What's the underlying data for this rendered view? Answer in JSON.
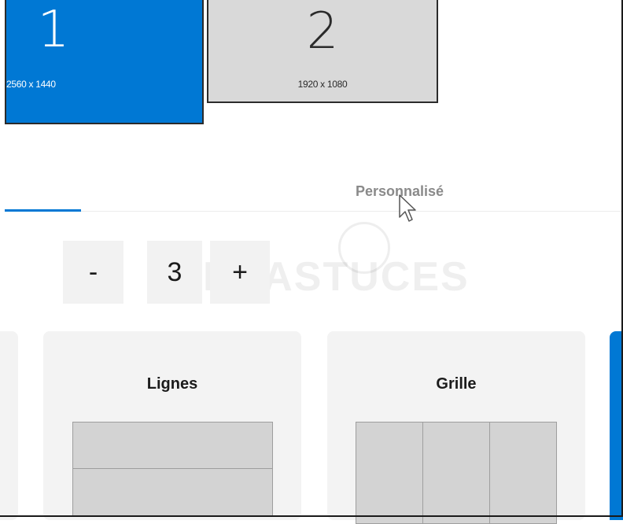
{
  "monitors": [
    {
      "number": "1",
      "resolution": "2560 x 1440",
      "selected": true
    },
    {
      "number": "2",
      "resolution": "1920 x 1080",
      "selected": false
    }
  ],
  "tabs": {
    "custom_label": "Personnalisé"
  },
  "stepper": {
    "minus_label": "-",
    "value": "3",
    "plus_label": "+"
  },
  "watermark": {
    "text": "PCASTUCES"
  },
  "layouts": {
    "lines": {
      "title": "Lignes",
      "rows": 2
    },
    "grid": {
      "title": "Grille",
      "columns": 3
    }
  },
  "colors": {
    "accent": "#0078d4",
    "card_bg": "#f3f3f3",
    "cell_bg": "#d3d3d3"
  }
}
